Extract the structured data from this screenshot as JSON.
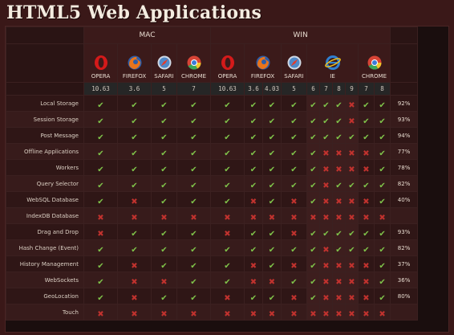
{
  "title": "HTML5 Web Applications",
  "groups": {
    "mac": "MAC",
    "win": "WIN"
  },
  "browsers": {
    "mac": [
      {
        "name": "OPERA",
        "icon": "opera-icon",
        "versions": [
          "10.63"
        ]
      },
      {
        "name": "FIREFOX",
        "icon": "firefox-icon",
        "versions": [
          "3.6"
        ]
      },
      {
        "name": "SAFARI",
        "icon": "safari-icon",
        "versions": [
          "5"
        ]
      },
      {
        "name": "CHROME",
        "icon": "chrome-icon",
        "versions": [
          "7"
        ]
      }
    ],
    "win": [
      {
        "name": "OPERA",
        "icon": "opera-icon",
        "versions": [
          "10.63"
        ]
      },
      {
        "name": "FIREFOX",
        "icon": "firefox-icon",
        "versions": [
          "3.6",
          "4.03"
        ]
      },
      {
        "name": "SAFARI",
        "icon": "safari-icon",
        "versions": [
          "5"
        ]
      },
      {
        "name": "IE",
        "icon": "ie-icon",
        "versions": [
          "6",
          "7",
          "8",
          "9"
        ]
      },
      {
        "name": "CHROME",
        "icon": "chrome-icon",
        "versions": [
          "7",
          "8"
        ]
      }
    ]
  },
  "marks": {
    "yes": "✔",
    "no": "✖"
  },
  "colors": {
    "yes": "#7fc24a",
    "no": "#c0322e",
    "background": "#3a1818"
  },
  "features": [
    {
      "label": "Local Storage",
      "support": "111111111110111",
      "pct": "92%"
    },
    {
      "label": "Session Storage",
      "support": "111111111110111",
      "pct": "93%"
    },
    {
      "label": "Post Message",
      "support": "111111111111111",
      "pct": "94%"
    },
    {
      "label": "Offline Applications",
      "support": "111111111000011",
      "pct": "77%"
    },
    {
      "label": "Workers",
      "support": "111111111000011",
      "pct": "78%"
    },
    {
      "label": "Query Selector",
      "support": "111111111011111",
      "pct": "82%"
    },
    {
      "label": "WebSQL Database",
      "support": "101110101000011",
      "pct": "40%"
    },
    {
      "label": "IndexDB Database",
      "support": "000000000000000",
      "pct": ""
    },
    {
      "label": "Drag and Drop",
      "support": "011101101111111",
      "pct": "93%"
    },
    {
      "label": "Hash Change (Event)",
      "support": "111111111011111",
      "pct": "82%"
    },
    {
      "label": "History Management",
      "support": "101110101000011",
      "pct": "37%"
    },
    {
      "label": "WebSockets",
      "support": "100110011000011",
      "pct": "36%"
    },
    {
      "label": "GeoLocation",
      "support": "101101101000011",
      "pct": "80%"
    },
    {
      "label": "Touch",
      "support": "000000000000000",
      "pct": ""
    }
  ]
}
